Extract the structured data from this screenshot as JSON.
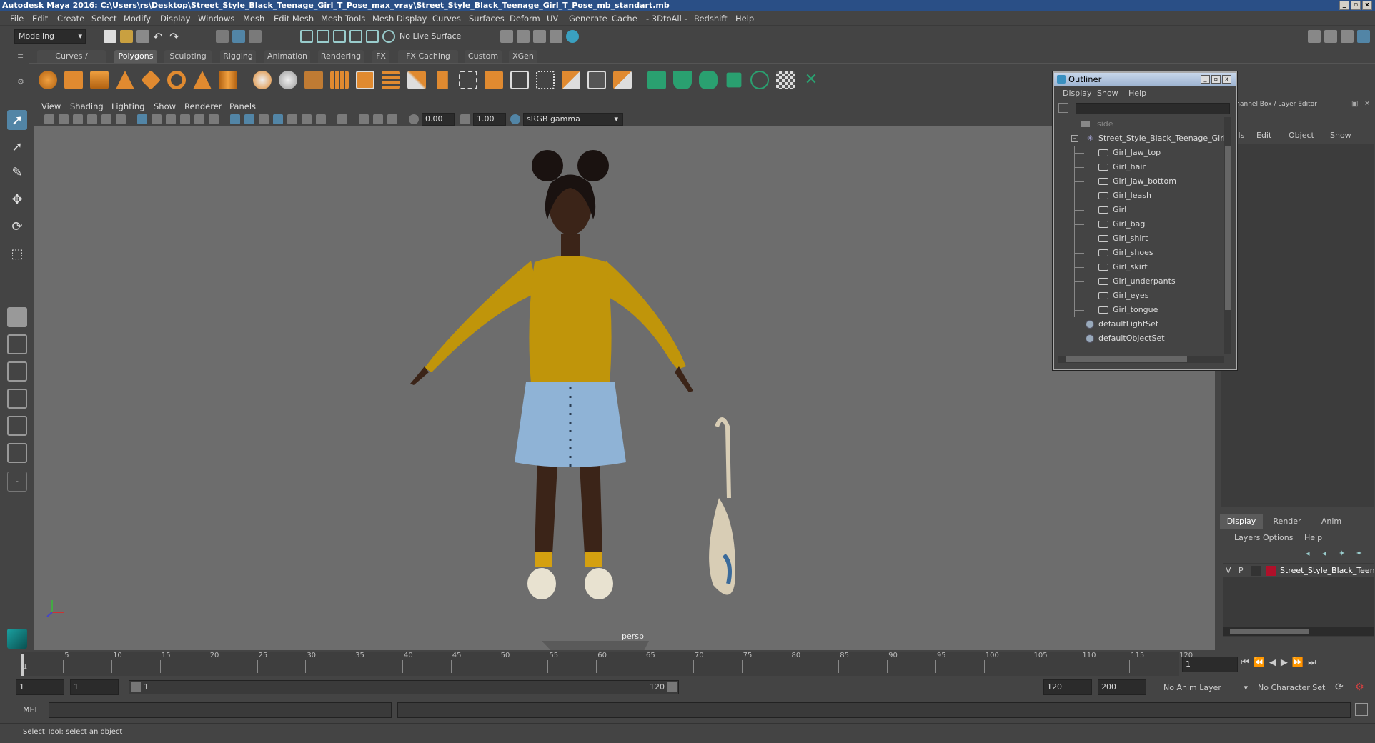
{
  "titlebar": {
    "title": "Autodesk Maya 2016: C:\\Users\\rs\\Desktop\\Street_Style_Black_Teenage_Girl_T_Pose_max_vray\\Street_Style_Black_Teenage_Girl_T_Pose_mb_standart.mb"
  },
  "menus": [
    "File",
    "Edit",
    "Create",
    "Select",
    "Modify",
    "Display",
    "Windows",
    "Mesh",
    "Edit Mesh",
    "Mesh Tools",
    "Mesh Display",
    "Curves",
    "Surfaces",
    "Deform",
    "UV",
    "Generate",
    "Cache",
    "- 3DtoAll -",
    "Redshift",
    "Help"
  ],
  "statusline": {
    "mode": "Modeling",
    "live_surface": "No Live Surface"
  },
  "shelf_tabs": [
    "Curves / Surfaces",
    "Polygons",
    "Sculpting",
    "Rigging",
    "Animation",
    "Rendering",
    "FX",
    "FX Caching",
    "Custom",
    "XGen"
  ],
  "shelf_active": "Polygons",
  "viewport": {
    "menus": [
      "View",
      "Shading",
      "Lighting",
      "Show",
      "Renderer",
      "Panels"
    ],
    "exposure": "0.00",
    "gamma": "1.00",
    "color_space": "sRGB gamma",
    "camera_label": "persp"
  },
  "outliner": {
    "title": "Outliner",
    "menus": [
      "Display",
      "Show",
      "Help"
    ],
    "items": [
      {
        "label": "side",
        "type": "camera"
      },
      {
        "label": "Street_Style_Black_Teenage_Girl_T",
        "type": "root"
      },
      {
        "label": "Girl_Jaw_top",
        "type": "mesh"
      },
      {
        "label": "Girl_hair",
        "type": "mesh"
      },
      {
        "label": "Girl_Jaw_bottom",
        "type": "mesh"
      },
      {
        "label": "Girl_leash",
        "type": "mesh"
      },
      {
        "label": "Girl",
        "type": "mesh"
      },
      {
        "label": "Girl_bag",
        "type": "mesh"
      },
      {
        "label": "Girl_shirt",
        "type": "mesh"
      },
      {
        "label": "Girl_shoes",
        "type": "mesh"
      },
      {
        "label": "Girl_skirt",
        "type": "mesh"
      },
      {
        "label": "Girl_underpants",
        "type": "mesh"
      },
      {
        "label": "Girl_eyes",
        "type": "mesh"
      },
      {
        "label": "Girl_tongue",
        "type": "mesh"
      },
      {
        "label": "defaultLightSet",
        "type": "set"
      },
      {
        "label": "defaultObjectSet",
        "type": "set"
      }
    ]
  },
  "channelbox": {
    "title": "Channel Box / Layer Editor",
    "menus": [
      "annels",
      "Edit",
      "Object",
      "Show"
    ]
  },
  "layer_editor": {
    "tabs": [
      "Display",
      "Render",
      "Anim"
    ],
    "menus": [
      "Layers",
      "Options",
      "Help"
    ],
    "layer": {
      "v": "V",
      "p": "P",
      "name": "Street_Style_Black_Teen",
      "color": "#b0102a"
    }
  },
  "timeline": {
    "ticks": [
      "5",
      "10",
      "15",
      "20",
      "25",
      "30",
      "35",
      "40",
      "45",
      "50",
      "55",
      "60",
      "65",
      "70",
      "75",
      "80",
      "85",
      "90",
      "95",
      "100",
      "105",
      "110",
      "115",
      "120"
    ],
    "start_tick": "1",
    "current_frame": "1"
  },
  "range": {
    "start": "1",
    "anim_start": "1",
    "slider_start": "1",
    "slider_end": "120",
    "end": "120",
    "anim_end": "200",
    "anim_layer": "No Anim Layer",
    "character_set": "No Character Set"
  },
  "cmdline": {
    "label": "MEL"
  },
  "helpline": {
    "text": "Select Tool: select an object"
  },
  "colors": {
    "accent": "#5285a6",
    "title_bg": "#2a4f86",
    "viewport_bg": "#6d6d6d",
    "sweater": "#c0950a",
    "skirt": "#8fb3d6"
  }
}
